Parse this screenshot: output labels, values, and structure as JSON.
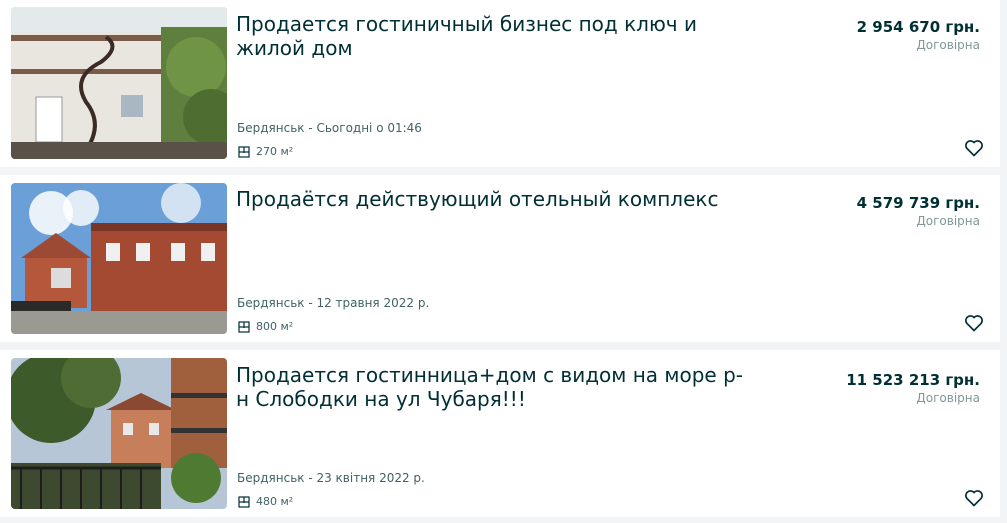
{
  "listings": [
    {
      "title": "Продается гостиничный бизнес под ключ и жилой дом",
      "price": "2 954 670 грн.",
      "negotiable": "Договірна",
      "location_date": "Бердянськ - Сьогодні о 01:46",
      "area": "270 м²"
    },
    {
      "title": "Продаётся действующий отельный комплекс",
      "price": "4 579 739 грн.",
      "negotiable": "Договірна",
      "location_date": "Бердянськ - 12 травня 2022 р.",
      "area": "800 м²"
    },
    {
      "title": "Продается гостинница+дом с видом на море р-н Слободки на ул Чубаря!!!",
      "price": "11 523 213 грн.",
      "negotiable": "Договірна",
      "location_date": "Бердянськ - 23 квітня 2022 р.",
      "area": "480 м²"
    }
  ],
  "icons": {
    "area": "floorplan-icon",
    "favorite": "heart-outline-icon"
  },
  "colors": {
    "text": "#002f34",
    "muted": "#7f9799",
    "background": "#f2f4f5",
    "card": "#ffffff"
  }
}
